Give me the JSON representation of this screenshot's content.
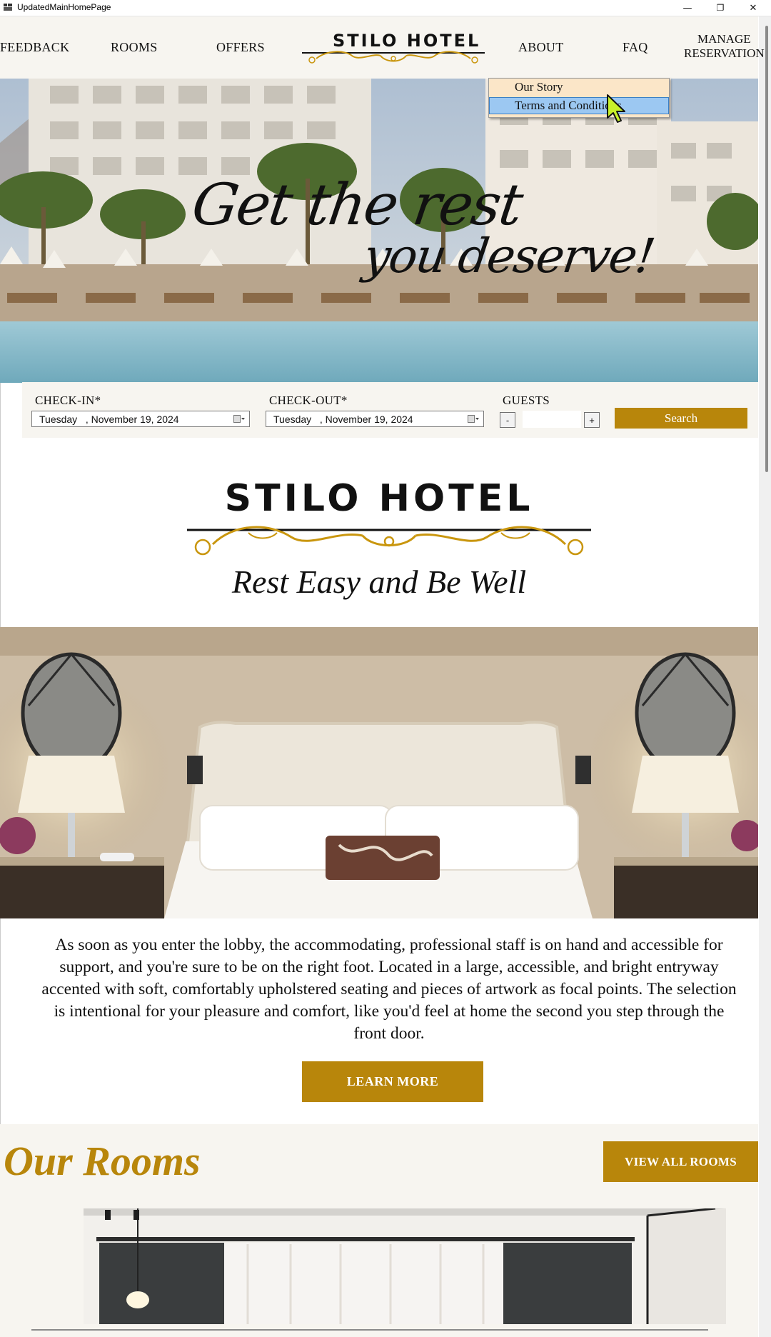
{
  "window": {
    "title": "UpdatedMainHomePage",
    "controls": {
      "minimize": "—",
      "restore": "❐",
      "close": "✕"
    }
  },
  "nav": {
    "items": [
      "FEEDBACK",
      "ROOMS",
      "OFFERS",
      "ABOUT",
      "FAQ"
    ],
    "logo_text": "STILO HOTEL",
    "manage_line1": "MANAGE",
    "manage_line2": "RESERVATION"
  },
  "about_menu": {
    "items": [
      "Our Story",
      "Terms and Conditions"
    ],
    "selected_index": 1
  },
  "hero": {
    "line1": "Get the rest",
    "line2": "you deserve!"
  },
  "booking": {
    "checkin_label": "CHECK-IN*",
    "checkin_value": "Tuesday   , November 19, 2024",
    "checkout_label": "CHECK-OUT*",
    "checkout_value": "Tuesday   , November 19, 2024",
    "guests_label": "GUESTS",
    "guests_value": "",
    "minus_label": "-",
    "plus_label": "+",
    "search_label": "Search"
  },
  "brand": {
    "title": "STILO HOTEL",
    "tagline": "Rest Easy and Be Well"
  },
  "about": {
    "description": "As soon as you enter the lobby, the accommodating, professional staff is on hand and accessible for support, and you're sure to be on the right foot. Located in a large, accessible, and bright entryway accented with soft, comfortably upholstered seating and pieces of artwork as focal points. The selection is intentional for your pleasure and comfort, like you'd feel at home the second you step through the front door.",
    "learn_more_label": "LEARN MORE"
  },
  "rooms": {
    "title": "Our Rooms",
    "view_all_label": "VIEW ALL ROOMS"
  },
  "colors": {
    "accent_gold": "#b8860b",
    "menu_bg": "#fbe6c8",
    "menu_selected": "#9cc8f2",
    "section_bg": "#f7f5f0"
  }
}
